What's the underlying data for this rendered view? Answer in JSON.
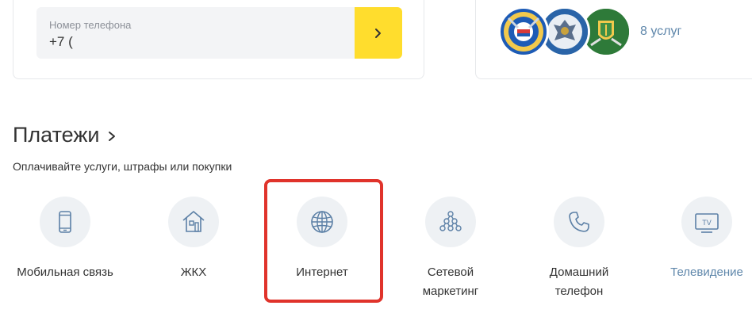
{
  "phone": {
    "label": "Номер телефона",
    "value": "+7 ("
  },
  "services": {
    "emblems": [
      "gibdd-emblem",
      "fns-emblem",
      "fssp-emblem"
    ],
    "link": "8 услуг"
  },
  "payments": {
    "title": "Платежи",
    "subtitle": "Оплачивайте услуги, штрафы или покупки",
    "tiles": [
      {
        "label": "Мобильная связь",
        "icon": "smartphone-icon"
      },
      {
        "label": "ЖКХ",
        "icon": "house-icon"
      },
      {
        "label": "Интернет",
        "icon": "globe-icon"
      },
      {
        "label": "Сетевой маркетинг",
        "icon": "network-icon"
      },
      {
        "label": "Домашний телефон",
        "icon": "phone-handset-icon"
      },
      {
        "label": "Телевидение",
        "icon": "tv-icon"
      }
    ]
  },
  "colors": {
    "accent_yellow": "#ffdd2d",
    "link_blue": "#5f87ab",
    "icon_blue": "#5c80a6",
    "highlight_red": "#e0332b"
  }
}
